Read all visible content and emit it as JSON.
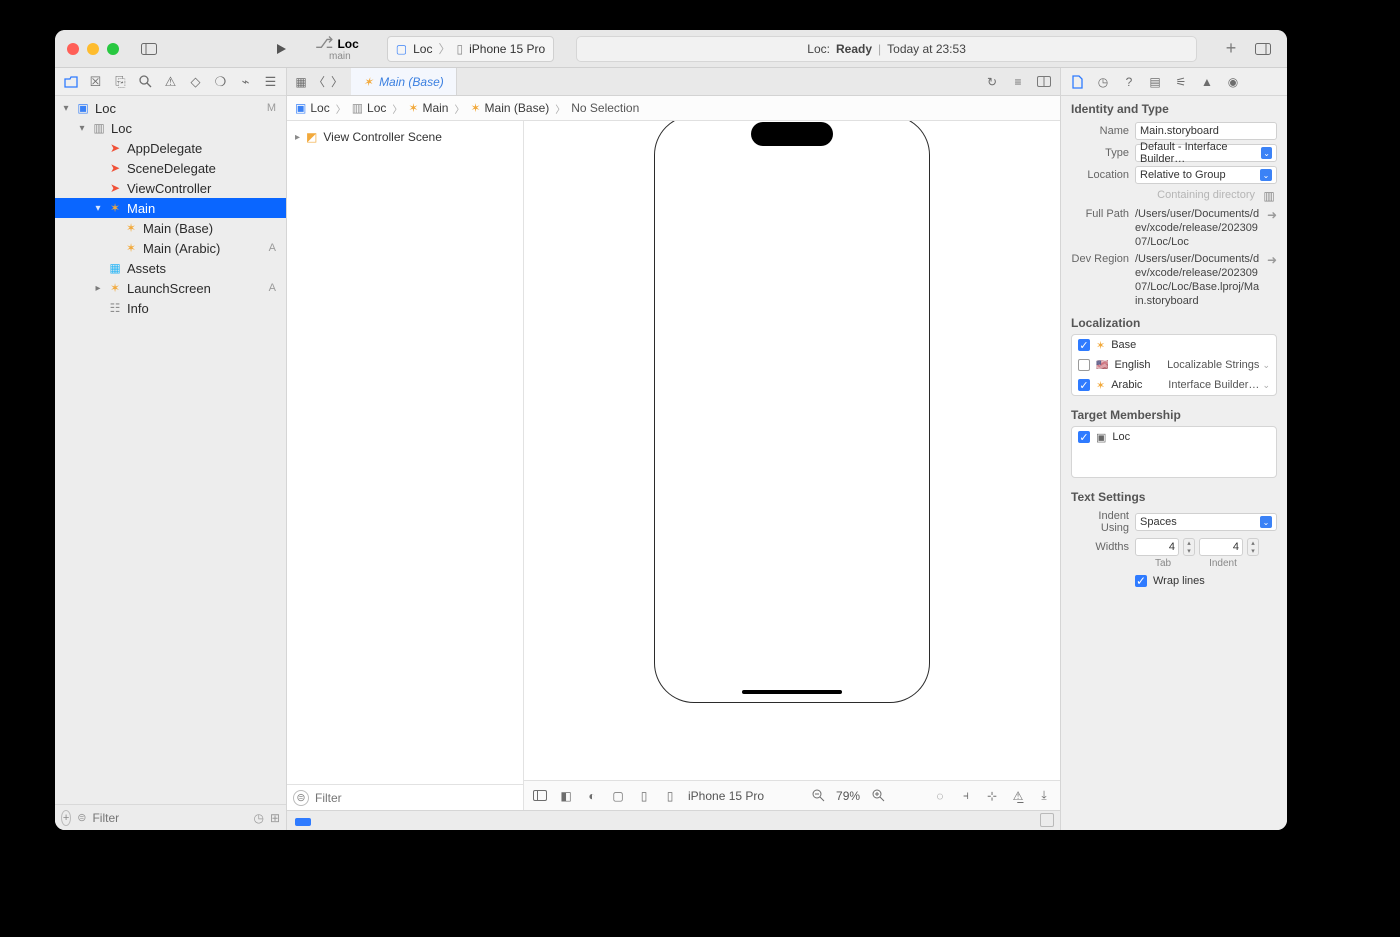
{
  "titlebar": {
    "scheme_project": "Loc",
    "scheme_branch": "main",
    "scheme_app": "Loc",
    "scheme_device": "iPhone 15 Pro",
    "status_prefix": "Loc:",
    "status_state": "Ready",
    "status_time": "Today at 23:53"
  },
  "navigator": {
    "items": [
      {
        "indent": 0,
        "disc": "▾",
        "icon": "app",
        "label": "Loc",
        "badge": "M"
      },
      {
        "indent": 1,
        "disc": "▾",
        "icon": "folder",
        "label": "Loc",
        "badge": ""
      },
      {
        "indent": 2,
        "disc": "",
        "icon": "swift",
        "label": "AppDelegate",
        "badge": ""
      },
      {
        "indent": 2,
        "disc": "",
        "icon": "swift",
        "label": "SceneDelegate",
        "badge": ""
      },
      {
        "indent": 2,
        "disc": "",
        "icon": "swift",
        "label": "ViewController",
        "badge": ""
      },
      {
        "indent": 2,
        "disc": "▾",
        "icon": "sb",
        "label": "Main",
        "badge": "",
        "selected": true
      },
      {
        "indent": 3,
        "disc": "",
        "icon": "sb",
        "label": "Main (Base)",
        "badge": ""
      },
      {
        "indent": 3,
        "disc": "",
        "icon": "sb",
        "label": "Main (Arabic)",
        "badge": "A"
      },
      {
        "indent": 2,
        "disc": "",
        "icon": "assets",
        "label": "Assets",
        "badge": ""
      },
      {
        "indent": 2,
        "disc": "▸",
        "icon": "sb",
        "label": "LaunchScreen",
        "badge": "A"
      },
      {
        "indent": 2,
        "disc": "",
        "icon": "plist",
        "label": "Info",
        "badge": ""
      }
    ],
    "filter_placeholder": "Filter"
  },
  "tabbar": {
    "tab_label": "Main (Base)"
  },
  "jumpbar": {
    "segments": [
      "Loc",
      "Loc",
      "Main",
      "Main (Base)",
      "No Selection"
    ]
  },
  "outline": {
    "row_label": "View Controller Scene",
    "filter_placeholder": "Filter"
  },
  "canvas_bottom": {
    "device": "iPhone 15 Pro",
    "zoom": "79%"
  },
  "inspector": {
    "identity_title": "Identity and Type",
    "name_label": "Name",
    "name_value": "Main.storyboard",
    "type_label": "Type",
    "type_value": "Default - Interface Builder…",
    "location_label": "Location",
    "location_value": "Relative to Group",
    "containing_label": "Containing directory",
    "fullpath_label": "Full Path",
    "fullpath_value": "/Users/user/Documents/dev/xcode/release/20230907/Loc/Loc",
    "devregion_label": "Dev Region",
    "devregion_value": "/Users/user/Documents/dev/xcode/release/20230907/Loc/Loc/Base.lproj/Main.storyboard",
    "loc_title": "Localization",
    "loc_items": [
      {
        "checked": true,
        "icon": "sb",
        "label": "Base",
        "right": ""
      },
      {
        "checked": false,
        "icon": "flag",
        "label": "English",
        "right": "Localizable Strings"
      },
      {
        "checked": true,
        "icon": "sb",
        "label": "Arabic",
        "right": "Interface Builder…"
      }
    ],
    "tm_title": "Target Membership",
    "tm_item": "Loc",
    "text_title": "Text Settings",
    "indent_label": "Indent Using",
    "indent_value": "Spaces",
    "widths_label": "Widths",
    "widths_tab": "4",
    "widths_indent": "4",
    "sub_tab": "Tab",
    "sub_indent": "Indent",
    "wrap_label": "Wrap lines"
  }
}
